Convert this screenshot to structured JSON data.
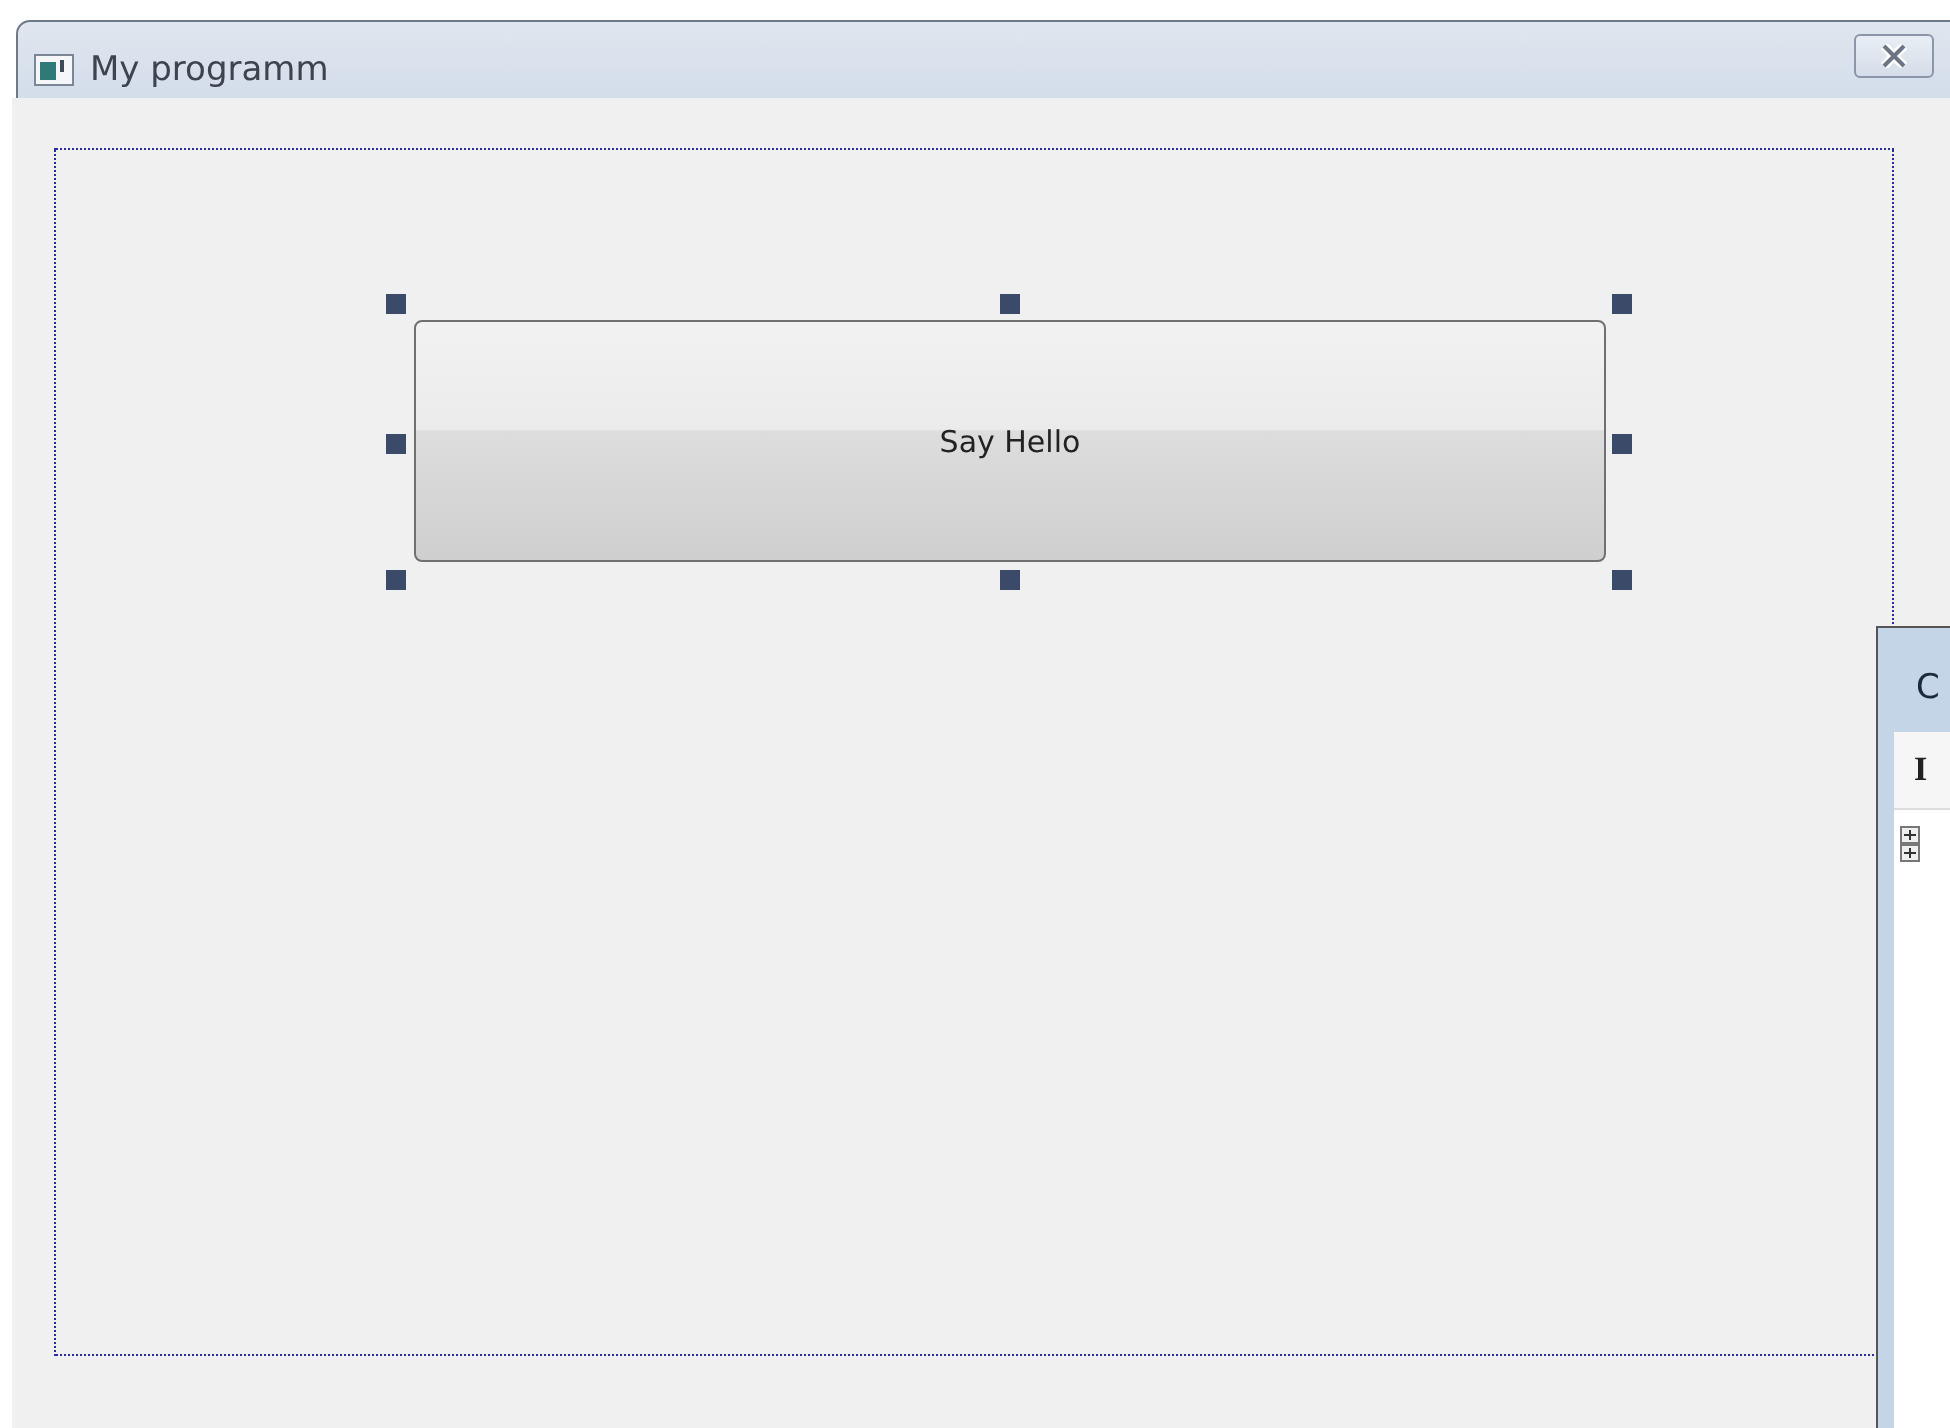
{
  "window": {
    "title": "My programm"
  },
  "form": {
    "controls": [
      {
        "kind": "button",
        "label": "Say Hello",
        "selected": true
      }
    ]
  },
  "side_panel": {
    "title": "C",
    "header": "I"
  }
}
